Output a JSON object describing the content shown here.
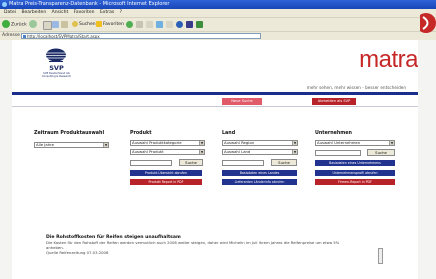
{
  "window": {
    "title": "Matra Preis-Transparenz-Datenbank - Microsoft Internet Explorer"
  },
  "menu": [
    "Datei",
    "Bearbeiten",
    "Ansicht",
    "Favoriten",
    "Extras",
    "?"
  ],
  "toolbar": {
    "back_label": "Zurück",
    "search_label": "Suchen",
    "favorites_label": "Favoriten"
  },
  "address": {
    "label": "Adresse",
    "url": "http://localhost/SVPMatra/Start.aspx"
  },
  "header": {
    "logo_brand": "SVP",
    "logo_sub1": "SVP Deutschland AG",
    "logo_sub2": "Consulting & Research",
    "brand": "matra",
    "slogan": "mehr sehen, mehr wissen - besser entscheiden"
  },
  "nav": {
    "news_button": "Neue Suche",
    "logout_button": "Abmelden als SVP"
  },
  "form": {
    "period": {
      "heading": "Zeitraum Produktauswahl",
      "select_value": "Alle Jahre"
    },
    "product": {
      "heading": "Produkt",
      "category_select": "Auswahl Produktkategorie",
      "product_select": "Auswahl Produkt",
      "search_button": "Suche",
      "overview_button": "Produkt-Übersicht abrufen",
      "report_button": "Produkt Report in PDF"
    },
    "country": {
      "heading": "Land",
      "region_select": "Auswahl Region",
      "country_select": "Auswahl Land",
      "search_button": "Suche",
      "overview_button": "Basisdaten eines Landes",
      "report_button": "Lieferanten Länderinfo abrufen"
    },
    "company": {
      "heading": "Unternehmen",
      "company_select": "Auswahl Unternehmen",
      "search_button": "Suche",
      "overview_button": "Basisdaten eines Unternehmens",
      "profile_button": "Unternehmensprofil abrufen",
      "report_button": "Firmen-Report in PDF"
    }
  },
  "news": {
    "title": "Die Rohstoffkosten für Reifen steigen unaufhaltsam",
    "text": "Die Kosten für den Rohstoff der Reifen werden vermutlich auch 2008 weiter steigen, daher wird Michelin im Juli ihrem Jahres die Reifenpreise um etwa 5% anheben.",
    "source": "Quelle Reifenzeitung 07.03.2008"
  },
  "colors": {
    "brand_red": "#c62828",
    "navy": "#1b2d8a",
    "titlebar_blue": "#2f63d8"
  }
}
